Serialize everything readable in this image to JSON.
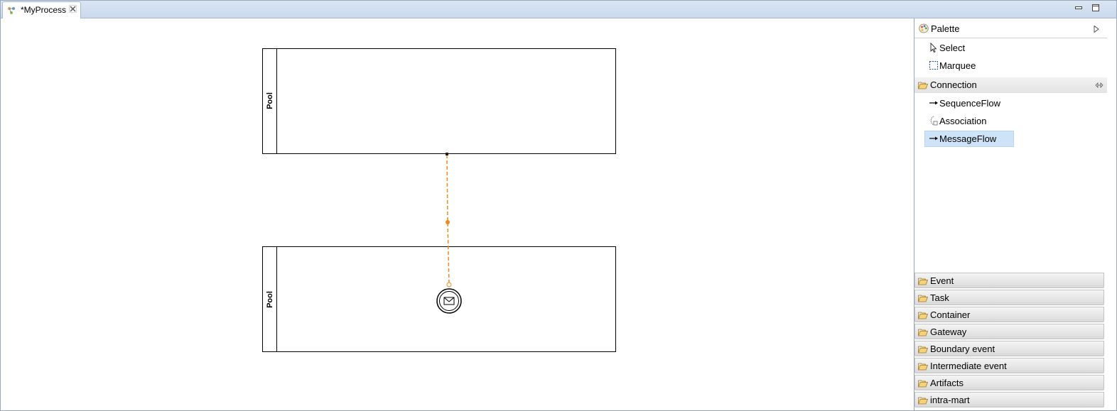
{
  "window": {
    "tab_title": "*MyProcess",
    "tab_icon": "process-diagram-icon",
    "close_icon": "close-icon",
    "minimize_icon": "minimize-icon",
    "maximize_icon": "maximize-icon"
  },
  "diagram": {
    "pools": [
      {
        "label": "Pool"
      },
      {
        "label": "Pool"
      }
    ],
    "message_flow_color": "#f08a1c",
    "start_event_type": "message-start-event"
  },
  "palette": {
    "title": "Palette",
    "tools": [
      {
        "label": "Select",
        "icon": "arrow-pointer-icon"
      },
      {
        "label": "Marquee",
        "icon": "marquee-icon"
      }
    ],
    "connection_drawer": {
      "label": "Connection",
      "items": [
        {
          "label": "SequenceFlow",
          "icon": "arrow-right-icon"
        },
        {
          "label": "Association",
          "icon": "association-icon"
        },
        {
          "label": "MessageFlow",
          "icon": "arrow-right-icon",
          "selected": true
        }
      ]
    },
    "drawers": [
      {
        "label": "Event"
      },
      {
        "label": "Task"
      },
      {
        "label": "Container"
      },
      {
        "label": "Gateway"
      },
      {
        "label": "Boundary event"
      },
      {
        "label": "Intermediate event"
      },
      {
        "label": "Artifacts"
      },
      {
        "label": "intra-mart"
      }
    ],
    "selected_color": "#cfe3f8",
    "folder_color": "#e8b84a"
  }
}
